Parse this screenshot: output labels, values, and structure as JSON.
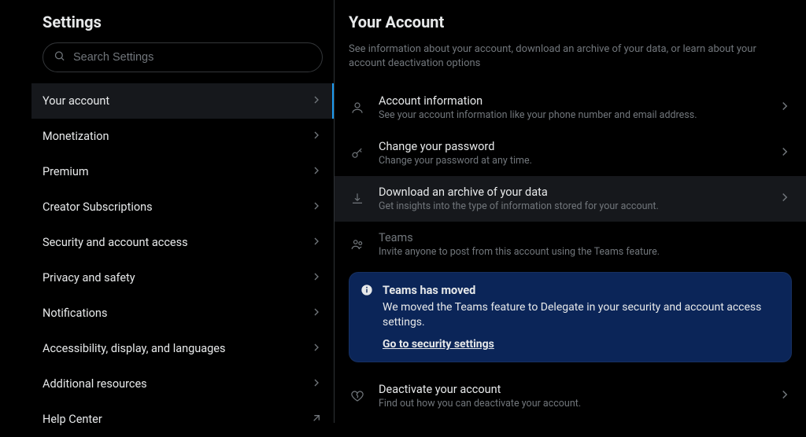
{
  "sidebar": {
    "title": "Settings",
    "search_placeholder": "Search Settings",
    "items": [
      {
        "label": "Your account",
        "icon": "chevron",
        "active": true
      },
      {
        "label": "Monetization",
        "icon": "chevron"
      },
      {
        "label": "Premium",
        "icon": "chevron"
      },
      {
        "label": "Creator Subscriptions",
        "icon": "chevron"
      },
      {
        "label": "Security and account access",
        "icon": "chevron"
      },
      {
        "label": "Privacy and safety",
        "icon": "chevron"
      },
      {
        "label": "Notifications",
        "icon": "chevron"
      },
      {
        "label": "Accessibility, display, and languages",
        "icon": "chevron"
      },
      {
        "label": "Additional resources",
        "icon": "chevron"
      },
      {
        "label": "Help Center",
        "icon": "external"
      }
    ]
  },
  "main": {
    "title": "Your Account",
    "description": "See information about your account, download an archive of your data, or learn about your account deactivation options",
    "rows": [
      {
        "icon": "user",
        "title": "Account information",
        "sub": "See your account information like your phone number and email address."
      },
      {
        "icon": "key",
        "title": "Change your password",
        "sub": "Change your password at any time."
      },
      {
        "icon": "download",
        "title": "Download an archive of your data",
        "sub": "Get insights into the type of information stored for your account.",
        "highlight": true
      },
      {
        "icon": "users",
        "title": "Teams",
        "sub": "Invite anyone to post from this account using the Teams feature.",
        "disabled": true
      },
      {
        "icon": "heart",
        "title": "Deactivate your account",
        "sub": "Find out how you can deactivate your account."
      }
    ],
    "info": {
      "title": "Teams has moved",
      "body": "We moved the Teams feature to Delegate in your security and account access settings.",
      "link": "Go to security settings"
    }
  }
}
